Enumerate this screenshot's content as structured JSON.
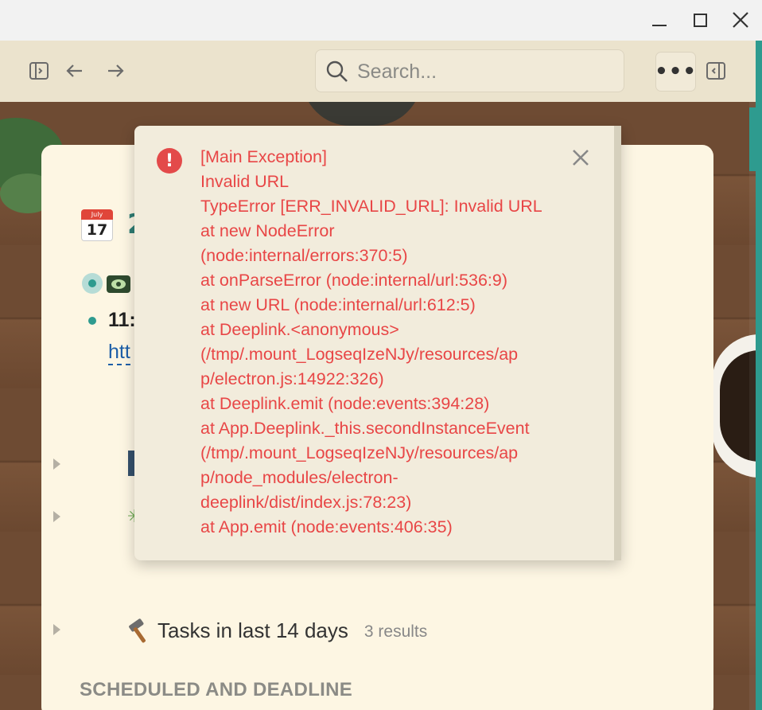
{
  "window": {
    "controls": [
      "minimize",
      "maximize",
      "close"
    ]
  },
  "toolbar": {
    "search": {
      "placeholder": "Search..."
    },
    "more_label": "•••"
  },
  "page": {
    "title_peek": "2",
    "time_peek": "11:5",
    "link_peek": "htt",
    "tasks_query": {
      "title": "Tasks in last 14 days",
      "count": "3 results"
    },
    "section_heading": "SCHEDULED AND DEADLINE",
    "calendar_icon": {
      "month": "July",
      "day": "17"
    }
  },
  "error_popup": {
    "lines": [
      "[Main Exception]",
      "Invalid URL",
      "TypeError [ERR_INVALID_URL]: Invalid URL",
      "at new NodeError",
      "(node:internal/errors:370:5)",
      "at onParseError (node:internal/url:536:9)",
      "at new URL (node:internal/url:612:5)",
      "at Deeplink.<anonymous>",
      "(/tmp/.mount_LogseqIzeNJy/resources/ap",
      "p/electron.js:14922:326)",
      "at Deeplink.emit (node:events:394:28)",
      "at App.Deeplink._this.secondInstanceEvent",
      "(/tmp/.mount_LogseqIzeNJy/resources/ap",
      "p/node_modules/electron-",
      "deeplink/dist/index.js:78:23)",
      "at App.emit (node:events:406:35)"
    ],
    "color": "#e84646"
  },
  "colors": {
    "accent": "#2e9b8f",
    "toolbar_bg": "#ebe3cd",
    "card_bg": "#fdf6e3",
    "error": "#e34a4a"
  }
}
